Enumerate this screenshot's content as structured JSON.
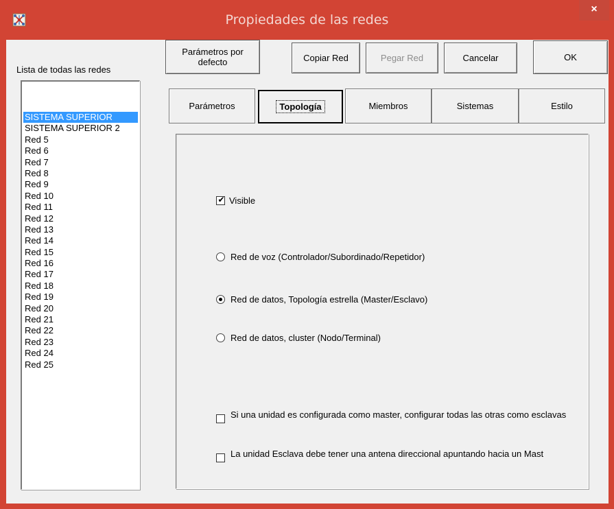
{
  "window": {
    "title": "Propiedades de las redes",
    "close_label": "×"
  },
  "list": {
    "label": "Lista de todas las redes",
    "items": [
      "SISTEMA SUPERIOR",
      "SISTEMA SUPERIOR 2",
      "Red  5",
      "Red  6",
      "Red  7",
      "Red  8",
      "Red  9",
      "Red 10",
      "Red 11",
      "Red 12",
      "Red 13",
      "Red 14",
      "Red 15",
      "Red 16",
      "Red 17",
      "Red 18",
      "Red 19",
      "Red 20",
      "Red 21",
      "Red 22",
      "Red 23",
      "Red 24",
      "Red 25"
    ],
    "selected_index": 0
  },
  "toolbar": {
    "defaults_label": "Parámetros por defecto",
    "copy_label": "Copiar Red",
    "paste_label": "Pegar Red",
    "cancel_label": "Cancelar",
    "ok_label": "OK"
  },
  "tabs": {
    "parametros": "Parámetros",
    "topologia": "Topología",
    "miembros": "Miembros",
    "sistemas": "Sistemas",
    "estilo": "Estilo",
    "active": "Topología"
  },
  "topology": {
    "visible_label": "Visible",
    "visible_checked": true,
    "radio_voice": "Red de voz (Controlador/Subordinado/Repetidor)",
    "radio_star": "Red de datos, Topología estrella (Master/Esclavo)",
    "radio_cluster": "Red de datos, cluster (Nodo/Terminal)",
    "selected_radio": "Red de datos, Topología estrella (Master/Esclavo)",
    "opt_master_label": "Si una unidad es configurada como master, configurar todas las otras como esclavas",
    "opt_master_checked": false,
    "opt_antenna_label": "La unidad Esclava debe tener una antena direccional apuntando hacia un Mast",
    "opt_antenna_checked": false
  },
  "icons": {
    "app": "network-app-icon",
    "close": "close-icon",
    "check": "checkmark-icon"
  },
  "colors": {
    "titlebar": "#d24434",
    "selection": "#3399ff",
    "dialog_bg": "#f0f0f0"
  }
}
